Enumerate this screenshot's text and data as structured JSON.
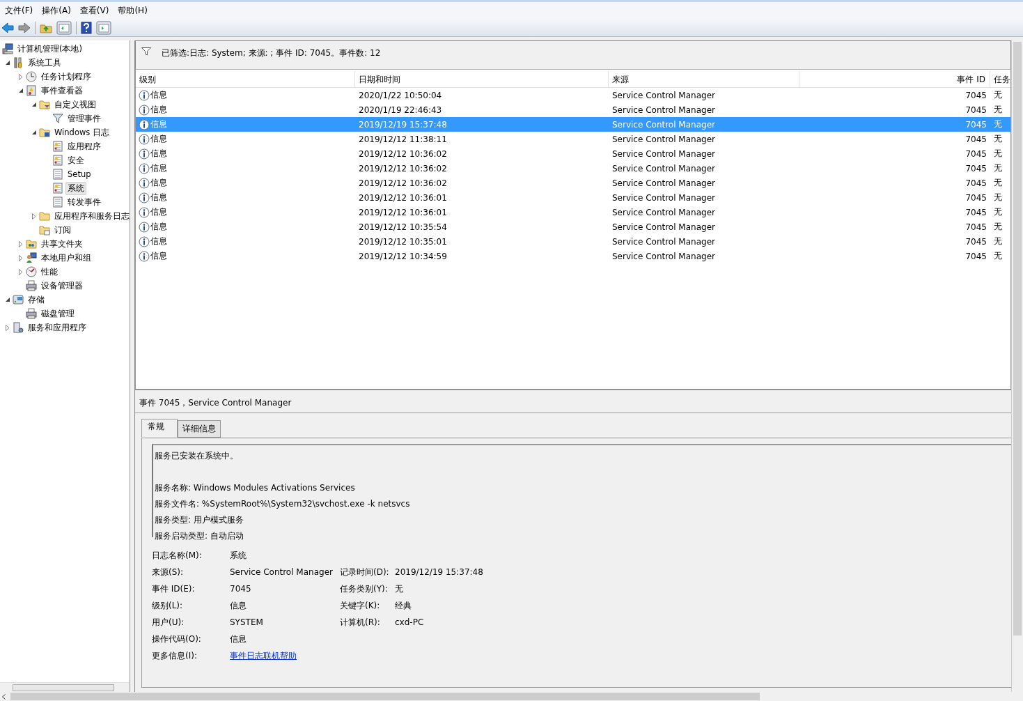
{
  "menu": [
    {
      "label": "文件(F)"
    },
    {
      "label": "操作(A)"
    },
    {
      "label": "查看(V)"
    },
    {
      "label": "帮助(H)"
    }
  ],
  "toolbar": [
    {
      "kind": "back",
      "disabled": false
    },
    {
      "kind": "forward",
      "disabled": true
    },
    {
      "kind": "up",
      "disabled": false
    },
    {
      "kind": "pane-left",
      "disabled": false
    },
    {
      "kind": "help",
      "disabled": false
    },
    {
      "kind": "pane-right",
      "disabled": false
    }
  ],
  "tree": [
    {
      "label": "计算机管理(本地)",
      "kind": "computer",
      "selected": false,
      "children": [
        {
          "label": "系统工具",
          "kind": "tools",
          "expanded": true,
          "selected": false,
          "children": [
            {
              "label": "任务计划程序",
              "kind": "clock",
              "expanded": false,
              "selected": false
            },
            {
              "label": "事件查看器",
              "kind": "viewer",
              "expanded": true,
              "selected": false,
              "children": [
                {
                  "label": "自定义视图",
                  "kind": "folder-filter",
                  "expanded": true,
                  "selected": false,
                  "children": [
                    {
                      "label": "管理事件",
                      "kind": "filter",
                      "selected": false
                    }
                  ]
                },
                {
                  "label": "Windows 日志",
                  "kind": "folder-log",
                  "expanded": true,
                  "selected": false,
                  "children": [
                    {
                      "label": "应用程序",
                      "kind": "log-warn",
                      "selected": false
                    },
                    {
                      "label": "安全",
                      "kind": "log-warn",
                      "selected": false
                    },
                    {
                      "label": "Setup",
                      "kind": "log",
                      "selected": false
                    },
                    {
                      "label": "系统",
                      "kind": "log-warn",
                      "selected": true
                    },
                    {
                      "label": "转发事件",
                      "kind": "log",
                      "selected": false
                    }
                  ]
                },
                {
                  "label": "应用程序和服务日志",
                  "kind": "folder",
                  "expanded": false,
                  "selected": false
                },
                {
                  "label": "订阅",
                  "kind": "folder-sub",
                  "selected": false
                }
              ]
            },
            {
              "label": "共享文件夹",
              "kind": "share",
              "expanded": false,
              "selected": false
            },
            {
              "label": "本地用户和组",
              "kind": "users",
              "expanded": false,
              "selected": false
            },
            {
              "label": "性能",
              "kind": "perf",
              "expanded": false,
              "selected": false
            },
            {
              "label": "设备管理器",
              "kind": "device",
              "selected": false
            }
          ]
        },
        {
          "label": "存储",
          "kind": "storage",
          "expanded": true,
          "selected": false,
          "children": [
            {
              "label": "磁盘管理",
              "kind": "device",
              "selected": false
            }
          ]
        },
        {
          "label": "服务和应用程序",
          "kind": "services",
          "expanded": false,
          "selected": false
        }
      ]
    }
  ],
  "filter_bar": {
    "text": "已筛选:日志: System; 来源: ; 事件 ID: 7045。事件数: 12"
  },
  "table": {
    "columns": [
      "级别",
      "日期和时间",
      "来源",
      "事件 ID",
      "任务"
    ],
    "rows": [
      {
        "level": "信息",
        "datetime": "2020/1/22 10:50:04",
        "source": "Service Control Manager",
        "event_id": "7045",
        "task": "无",
        "selected": false
      },
      {
        "level": "信息",
        "datetime": "2020/1/19 22:46:43",
        "source": "Service Control Manager",
        "event_id": "7045",
        "task": "无",
        "selected": false
      },
      {
        "level": "信息",
        "datetime": "2019/12/19 15:37:48",
        "source": "Service Control Manager",
        "event_id": "7045",
        "task": "无",
        "selected": true
      },
      {
        "level": "信息",
        "datetime": "2019/12/12 11:38:11",
        "source": "Service Control Manager",
        "event_id": "7045",
        "task": "无",
        "selected": false
      },
      {
        "level": "信息",
        "datetime": "2019/12/12 10:36:02",
        "source": "Service Control Manager",
        "event_id": "7045",
        "task": "无",
        "selected": false
      },
      {
        "level": "信息",
        "datetime": "2019/12/12 10:36:02",
        "source": "Service Control Manager",
        "event_id": "7045",
        "task": "无",
        "selected": false
      },
      {
        "level": "信息",
        "datetime": "2019/12/12 10:36:02",
        "source": "Service Control Manager",
        "event_id": "7045",
        "task": "无",
        "selected": false
      },
      {
        "level": "信息",
        "datetime": "2019/12/12 10:36:01",
        "source": "Service Control Manager",
        "event_id": "7045",
        "task": "无",
        "selected": false
      },
      {
        "level": "信息",
        "datetime": "2019/12/12 10:36:01",
        "source": "Service Control Manager",
        "event_id": "7045",
        "task": "无",
        "selected": false
      },
      {
        "level": "信息",
        "datetime": "2019/12/12 10:35:54",
        "source": "Service Control Manager",
        "event_id": "7045",
        "task": "无",
        "selected": false
      },
      {
        "level": "信息",
        "datetime": "2019/12/12 10:35:01",
        "source": "Service Control Manager",
        "event_id": "7045",
        "task": "无",
        "selected": false
      },
      {
        "level": "信息",
        "datetime": "2019/12/12 10:34:59",
        "source": "Service Control Manager",
        "event_id": "7045",
        "task": "无",
        "selected": false
      }
    ]
  },
  "detail": {
    "title": "事件 7045，Service Control Manager",
    "tabs": [
      {
        "label": "常规",
        "selected": true
      },
      {
        "label": "详细信息",
        "selected": false
      }
    ],
    "description": [
      "服务已安装在系统中。",
      "服务名称: Windows Modules Activations Services",
      "服务文件名: %SystemRoot%\\System32\\svchost.exe -k netsvcs",
      "服务类型: 用户模式服务",
      "服务启动类型: 自动启动"
    ],
    "fields": [
      [
        {
          "label": "日志名称(M):",
          "value": "系统"
        }
      ],
      [
        {
          "label": "来源(S):",
          "value": "Service Control Manager"
        },
        {
          "label": "记录时间(D):",
          "value": "2019/12/19 15:37:48"
        }
      ],
      [
        {
          "label": "事件 ID(E):",
          "value": "7045"
        },
        {
          "label": "任务类别(Y):",
          "value": "无"
        }
      ],
      [
        {
          "label": "级别(L):",
          "value": "信息"
        },
        {
          "label": "关键字(K):",
          "value": "经典"
        }
      ],
      [
        {
          "label": "用户(U):",
          "value": "SYSTEM"
        },
        {
          "label": "计算机(R):",
          "value": "cxd-PC"
        }
      ],
      [
        {
          "label": "操作代码(O):",
          "value": "信息"
        }
      ],
      [
        {
          "label": "更多信息(I):",
          "value": "事件日志联机帮助",
          "kind": "link"
        }
      ]
    ]
  }
}
